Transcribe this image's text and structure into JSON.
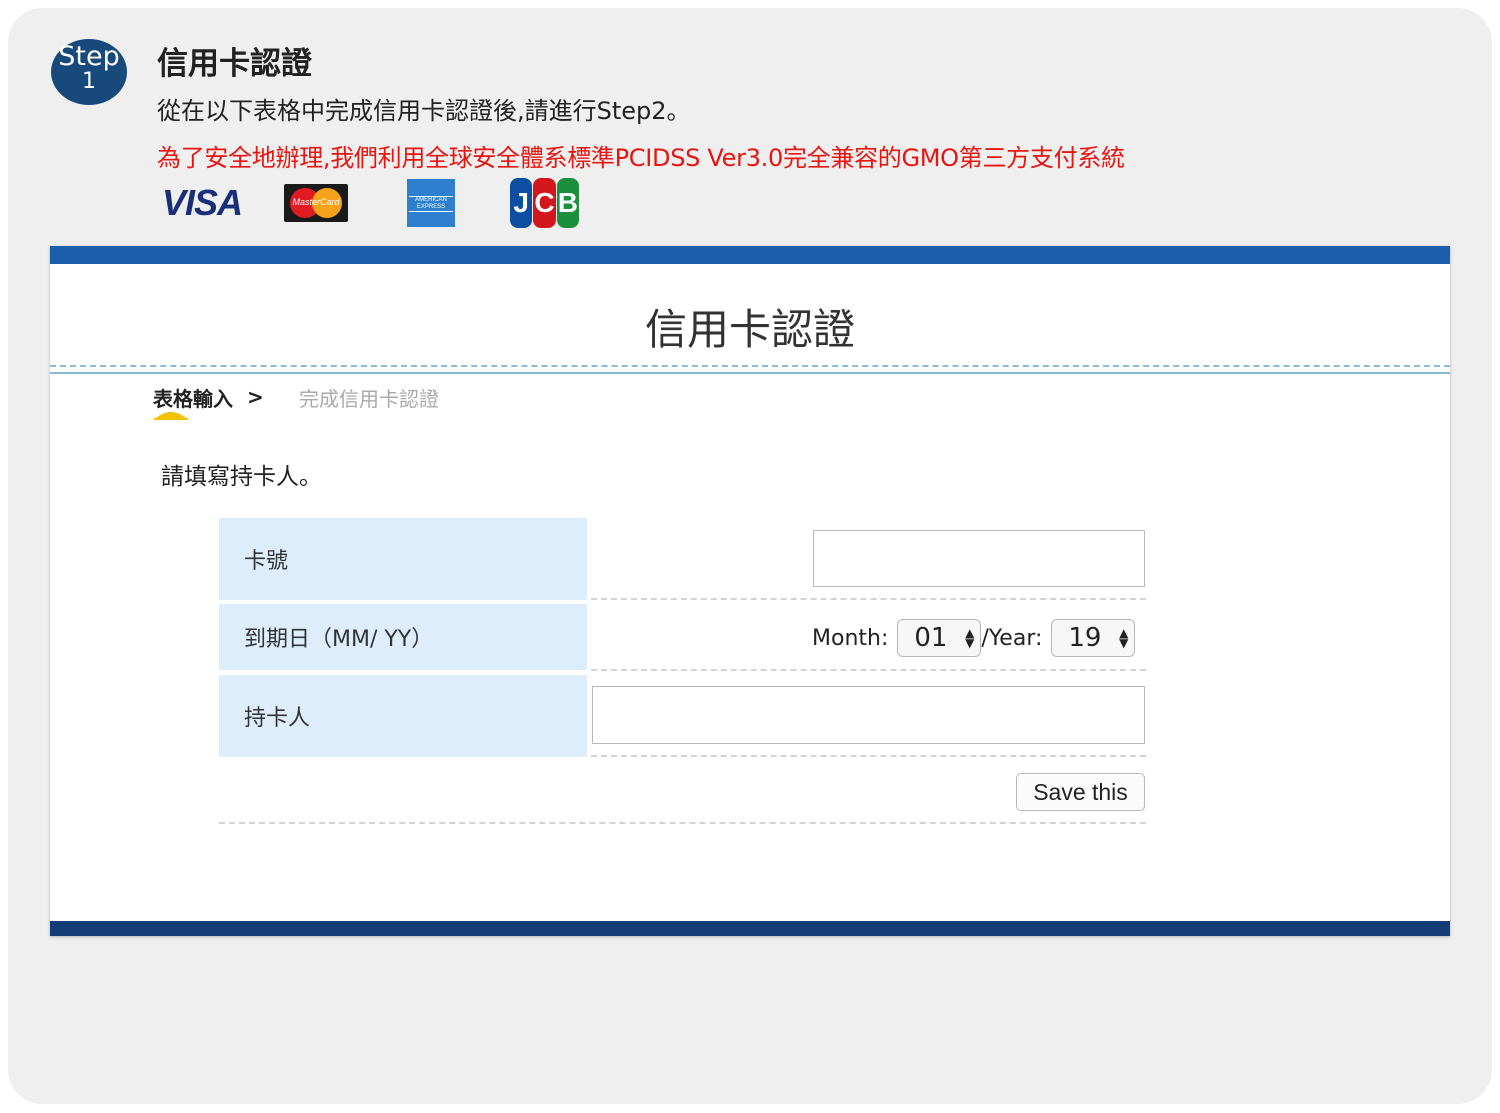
{
  "header": {
    "step_word": "Step",
    "step_number": "1",
    "title": "信用卡認證",
    "subtitle": "從在以下表格中完成信用卡認證後,請進行Step2。",
    "notice": "為了安全地辦理,我們利用全球安全體系標準PCIDSS Ver3.0完全兼容的GMO第三方支付系統",
    "notice_color": "#e8140f"
  },
  "card_brands": {
    "visa": "VISA",
    "mastercard": "MasterCard",
    "amex": "AMERICAN EXPRESS",
    "jcb": [
      "J",
      "C",
      "B"
    ]
  },
  "panel": {
    "title": "信用卡認證",
    "accent_top": "#1b5fab",
    "accent_bottom": "#143d77"
  },
  "breadcrumb": {
    "active": "表格輸入",
    "separator": ">",
    "next": "完成信用卡認證"
  },
  "form": {
    "instruction": "請填寫持卡人。",
    "card_number_label": "卡號",
    "card_number_value": "",
    "expiry_label": "到期日（MM/ YY）",
    "month_label": "Month:",
    "month_value": "01",
    "year_label": "/Year:",
    "year_value": "19",
    "holder_label": "持卡人",
    "holder_value": "",
    "save_label": "Save this"
  }
}
